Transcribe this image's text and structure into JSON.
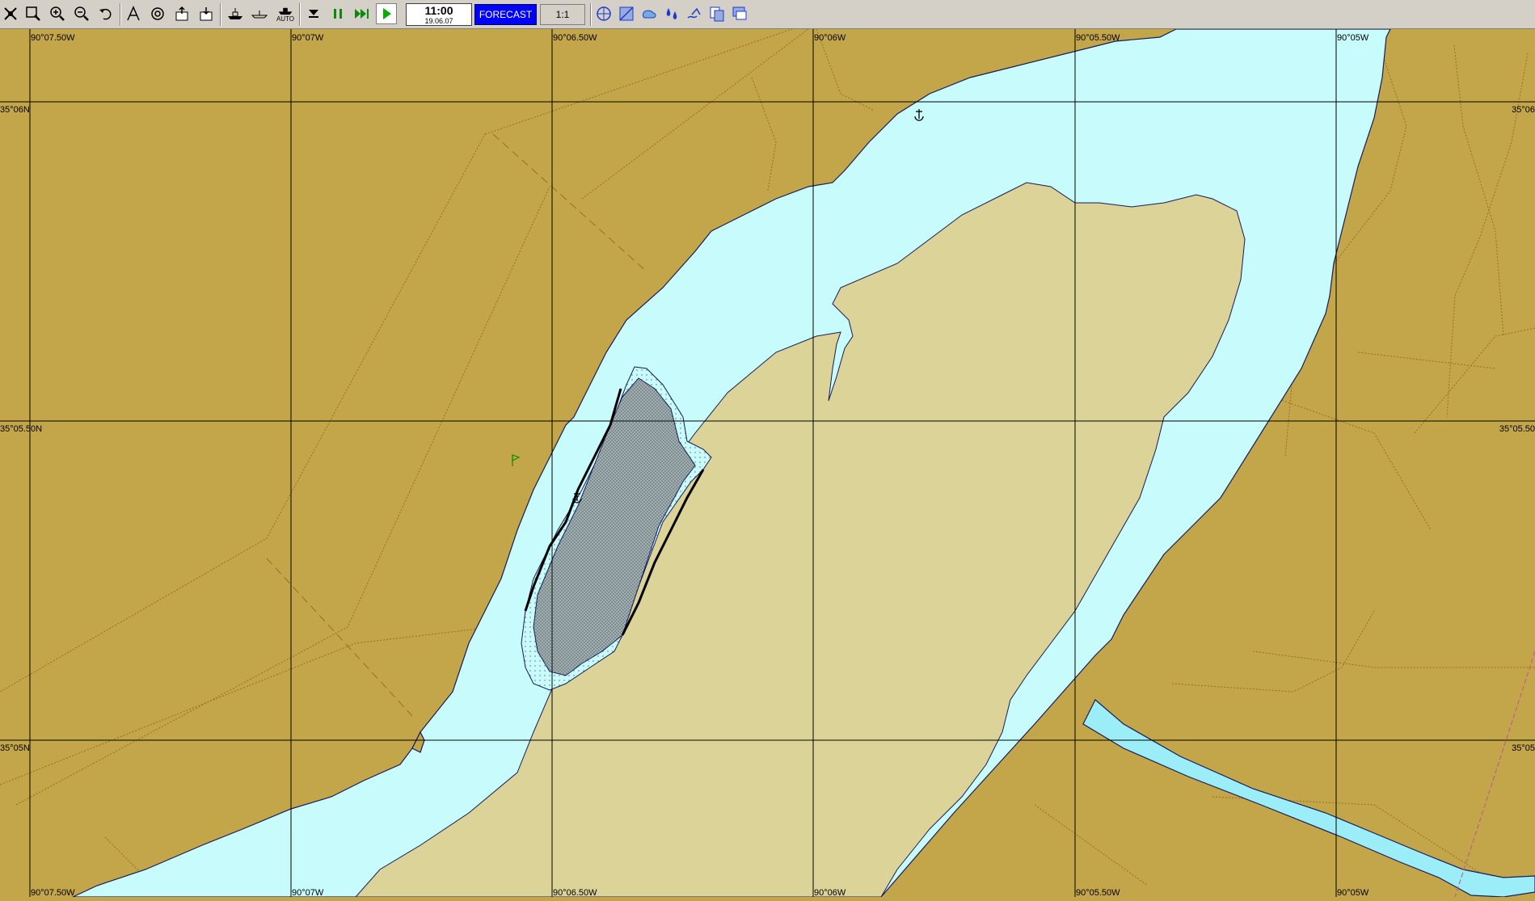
{
  "toolbar": {
    "time": "11:00",
    "date": "19.06.07",
    "forecast_label": "FORECAST",
    "scale": "1:1",
    "auto_label": "AUTO",
    "icons": [
      "move-icon",
      "zoom-window-icon",
      "zoom-in-icon",
      "zoom-out-icon",
      "undo-icon",
      "route-icon",
      "target-icon",
      "export-icon",
      "import-icon",
      "ship-icon",
      "ship-outline-icon",
      "auto-icon",
      "step-end-icon",
      "pause-icon",
      "fast-forward-icon",
      "play-icon",
      "globe-icon",
      "chart-grid-icon",
      "weather-icon",
      "depth-icon",
      "tide-icon",
      "copy-icon",
      "window-icon"
    ]
  },
  "chart": {
    "longitudes": [
      "90°07.50W",
      "90°07W",
      "90°06.50W",
      "90°06W",
      "90°05.50W",
      "90°05W"
    ],
    "latitudes": [
      "35°06N",
      "35°05.50N",
      "35°05N"
    ],
    "latitudes_right": [
      "35°06",
      "35°05.50",
      "35°05"
    ],
    "colors": {
      "land": "#c4a64a",
      "water": "#c8fbfb",
      "shoal": "#dbd397",
      "river_channel": "#9beef8",
      "grid": "#000000"
    }
  }
}
